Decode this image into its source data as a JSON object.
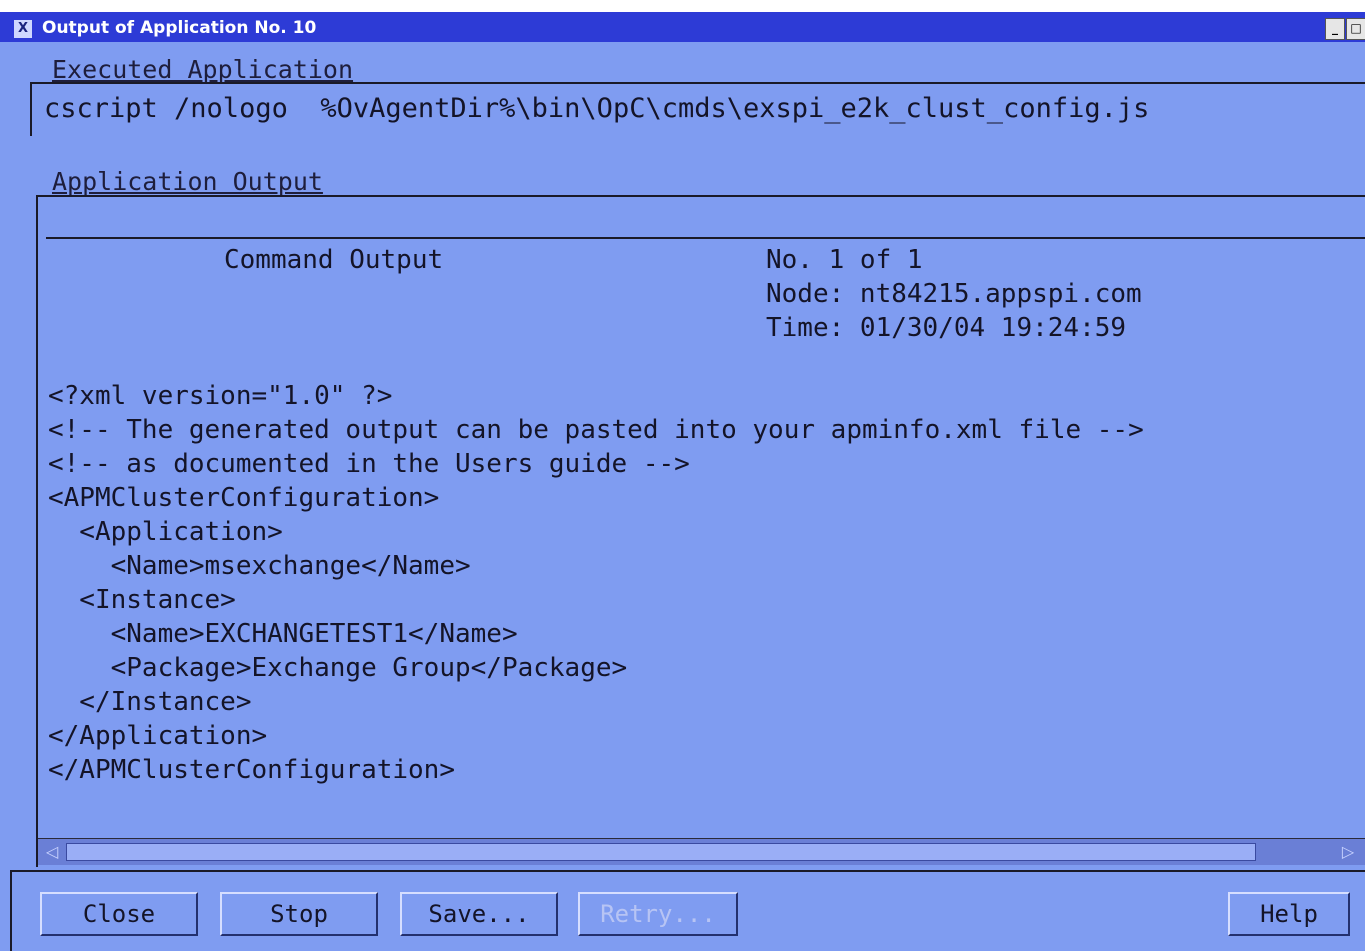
{
  "window": {
    "title": "Output of Application No. 10",
    "icon": "x-icon"
  },
  "title_buttons": {
    "minimize": "_",
    "maximize": "□"
  },
  "executed": {
    "label": "Executed Application",
    "command": "cscript /nologo  %OvAgentDir%\\bin\\OpC\\cmds\\exspi_e2k_clust_config.js"
  },
  "output": {
    "label": "Application Output",
    "header": {
      "title": "Command Output",
      "count": "No. 1 of 1",
      "node": "Node: nt84215.appspi.com",
      "time": "Time: 01/30/04 19:24:59"
    },
    "lines": [
      "<?xml version=\"1.0\" ?>",
      "<!-- The generated output can be pasted into your apminfo.xml file -->",
      "<!-- as documented in the Users guide -->",
      "<APMClusterConfiguration>",
      "  <Application>",
      "    <Name>msexchange</Name>",
      "  <Instance>",
      "    <Name>EXCHANGETEST1</Name>",
      "    <Package>Exchange Group</Package>",
      "  </Instance>",
      "</Application>",
      "</APMClusterConfiguration>"
    ]
  },
  "scroll": {
    "left_arrow": "◁",
    "right_arrow": "▷"
  },
  "buttons": {
    "close": "Close",
    "stop": "Stop",
    "save": "Save...",
    "retry": "Retry...",
    "help": "Help"
  }
}
